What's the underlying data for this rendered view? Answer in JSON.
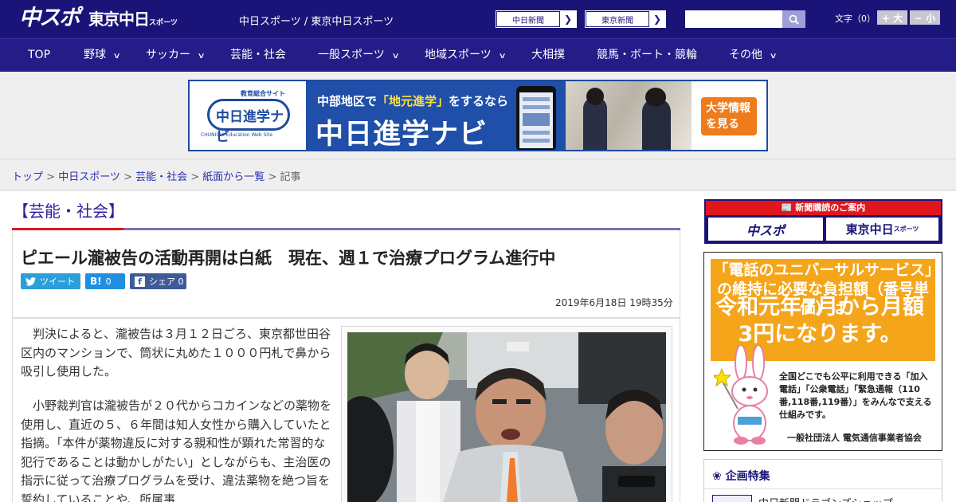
{
  "header": {
    "logo_chunichi": "中スポ",
    "logo_tokyo": "東京中日",
    "logo_tokyo_small": "スポーツ",
    "tagline": "中日スポーツ / 東京中日スポーツ",
    "ext_links": [
      {
        "label": "中日新聞"
      },
      {
        "label": "東京新聞"
      }
    ],
    "search_placeholder": "",
    "font_size_label": "文字（0）",
    "font_plus": "+ 大",
    "font_minus": "− 小"
  },
  "nav": {
    "items": [
      {
        "label": "TOP",
        "has_menu": false
      },
      {
        "label": "野球",
        "has_menu": true
      },
      {
        "label": "サッカー",
        "has_menu": true
      },
      {
        "label": "芸能・社会",
        "has_menu": false
      },
      {
        "label": "一般スポーツ",
        "has_menu": true
      },
      {
        "label": "地域スポーツ",
        "has_menu": true
      },
      {
        "label": "大相撲",
        "has_menu": false
      },
      {
        "label": "競馬・ボート・競輪",
        "has_menu": false
      },
      {
        "label": "その他",
        "has_menu": true
      }
    ]
  },
  "banner": {
    "logo_top": "教育総合サイト",
    "logo_text": "中日進学ナビ",
    "logo_sub": "CHUNICHI Education Web Site",
    "headline_pre": "中部地区で",
    "headline_hl": "「地元進学」",
    "headline_post": "をするなら",
    "main": "中日進学ナビ",
    "cta_line1": "大学情報",
    "cta_line2": "を見る"
  },
  "breadcrumb": {
    "items": [
      "トップ",
      "中日スポーツ",
      "芸能・社会",
      "紙面から一覧"
    ],
    "current": "記事",
    "sep": " > "
  },
  "article": {
    "category": "【芸能・社会】",
    "headline": "ピエール瀧被告の活動再開は白紙　現在、週１で治療プログラム進行中",
    "share": {
      "tweet": "ツイート",
      "hatena_count": "0",
      "facebook": "シェア",
      "facebook_count": "0"
    },
    "date": "2019年6月18日 19時35分",
    "paragraphs": [
      "判決によると、瀧被告は３月１２日ごろ、東京都世田谷区内のマンションで、筒状に丸めた１０００円札で鼻から吸引し使用した。",
      "小野裁判官は瀧被告が２０代からコカインなどの薬物を使用し、直近の５、６年間は知人女性から購入していたと指摘。「本件が薬物違反に対する親和性が顕れた常習的な犯行であることは動かしがたい」としながらも、主治医の指示に従って治療プログラムを受け、違法薬物を絶つ旨を誓約していることや、所属事"
    ]
  },
  "sidebar": {
    "subscribe_header": "新聞購読のご案内",
    "subscribe_left": "中スポ",
    "subscribe_right": "東京中日",
    "subscribe_right_small": "スポーツ",
    "ad_line1": "「電話のユニバーサルサービス」の維持に必要な負担額（番号単価）は",
    "ad_line2": "令和元年7月から月額3円になります。",
    "ad_desc": "全国どこでも公平に利用できる「加入電話」「公衆電話」「緊急通報（110番,118番,119番）」をみんなで支える仕組みです。",
    "ad_org": "一般社団法人 電気通信事業者協会",
    "feature_title": "企画特集",
    "feature_item": "中日新聞ドラゴンズショップ"
  }
}
